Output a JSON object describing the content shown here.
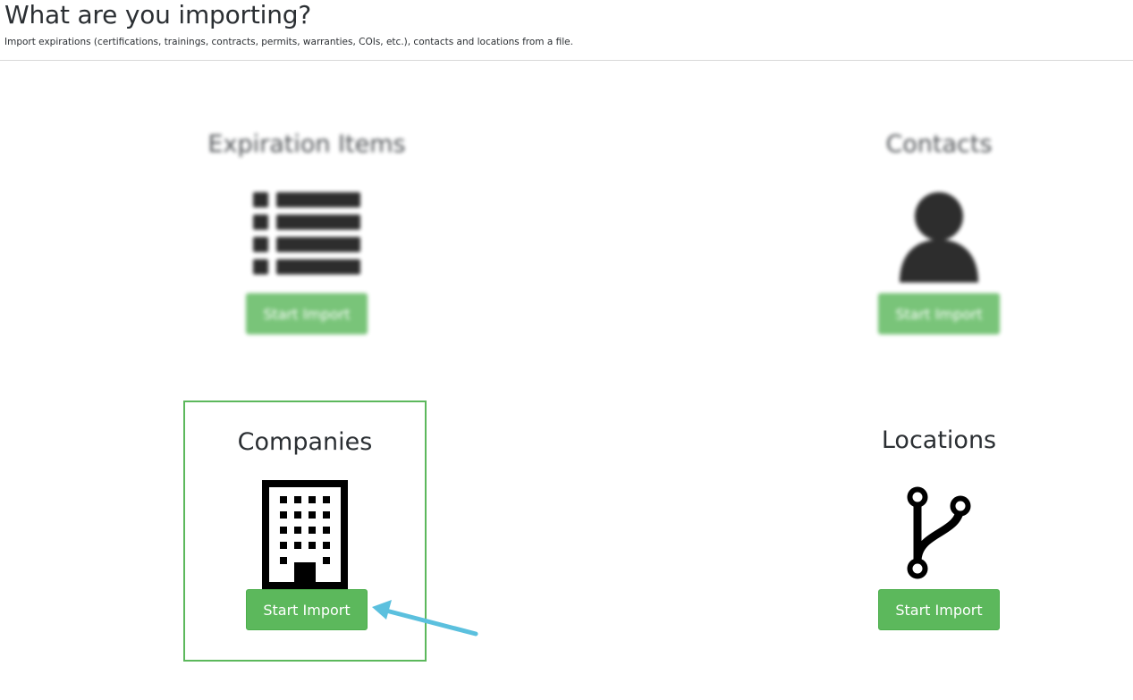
{
  "header": {
    "title": "What are you importing?",
    "subtitle": "Import expirations (certifications, trainings, contracts, permits, warranties, COIs, etc.), contacts and locations from a file."
  },
  "cards": [
    {
      "title": "Expiration Items",
      "button_label": "Start Import",
      "icon": "list-icon"
    },
    {
      "title": "Contacts",
      "button_label": "Start Import",
      "icon": "user-icon"
    },
    {
      "title": "Companies",
      "button_label": "Start Import",
      "icon": "building-icon",
      "selected": true
    },
    {
      "title": "Locations",
      "button_label": "Start Import",
      "icon": "branch-icon"
    }
  ],
  "colors": {
    "button": "#5cb85c",
    "selection_border": "#5cb85c",
    "annotation_arrow": "#5bc0de"
  }
}
